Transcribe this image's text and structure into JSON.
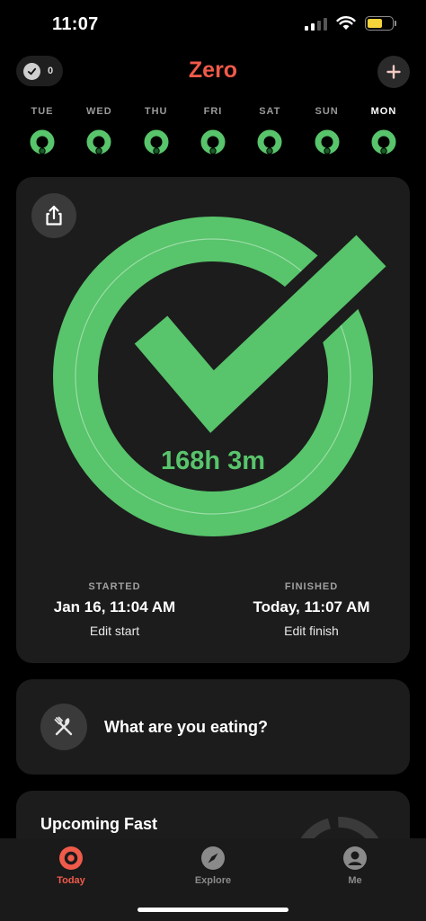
{
  "status_bar": {
    "time": "11:07"
  },
  "header": {
    "app_title": "Zero",
    "streak_count": "0",
    "add_icon": "plus-icon"
  },
  "week": {
    "days": [
      {
        "label": "TUE",
        "current": false
      },
      {
        "label": "WED",
        "current": false
      },
      {
        "label": "THU",
        "current": false
      },
      {
        "label": "FRI",
        "current": false
      },
      {
        "label": "SAT",
        "current": false
      },
      {
        "label": "SUN",
        "current": false
      },
      {
        "label": "MON",
        "current": true
      }
    ]
  },
  "timer": {
    "duration": "168h 3m",
    "progress": 1.0,
    "started_label": "STARTED",
    "started_value": "Jan 16, 11:04 AM",
    "edit_start": "Edit start",
    "finished_label": "FINISHED",
    "finished_value": "Today, 11:07 AM",
    "edit_finish": "Edit finish"
  },
  "eating": {
    "prompt": "What are you eating?"
  },
  "upcoming": {
    "title": "Upcoming Fast"
  },
  "tabs": [
    {
      "label": "Today",
      "icon": "today-ring-icon",
      "active": true
    },
    {
      "label": "Explore",
      "icon": "compass-icon",
      "active": false
    },
    {
      "label": "Me",
      "icon": "profile-icon",
      "active": false
    }
  ],
  "colors": {
    "accent": "#ef5a4a",
    "success": "#58c46b",
    "card": "#1c1c1c",
    "background": "#000000"
  }
}
